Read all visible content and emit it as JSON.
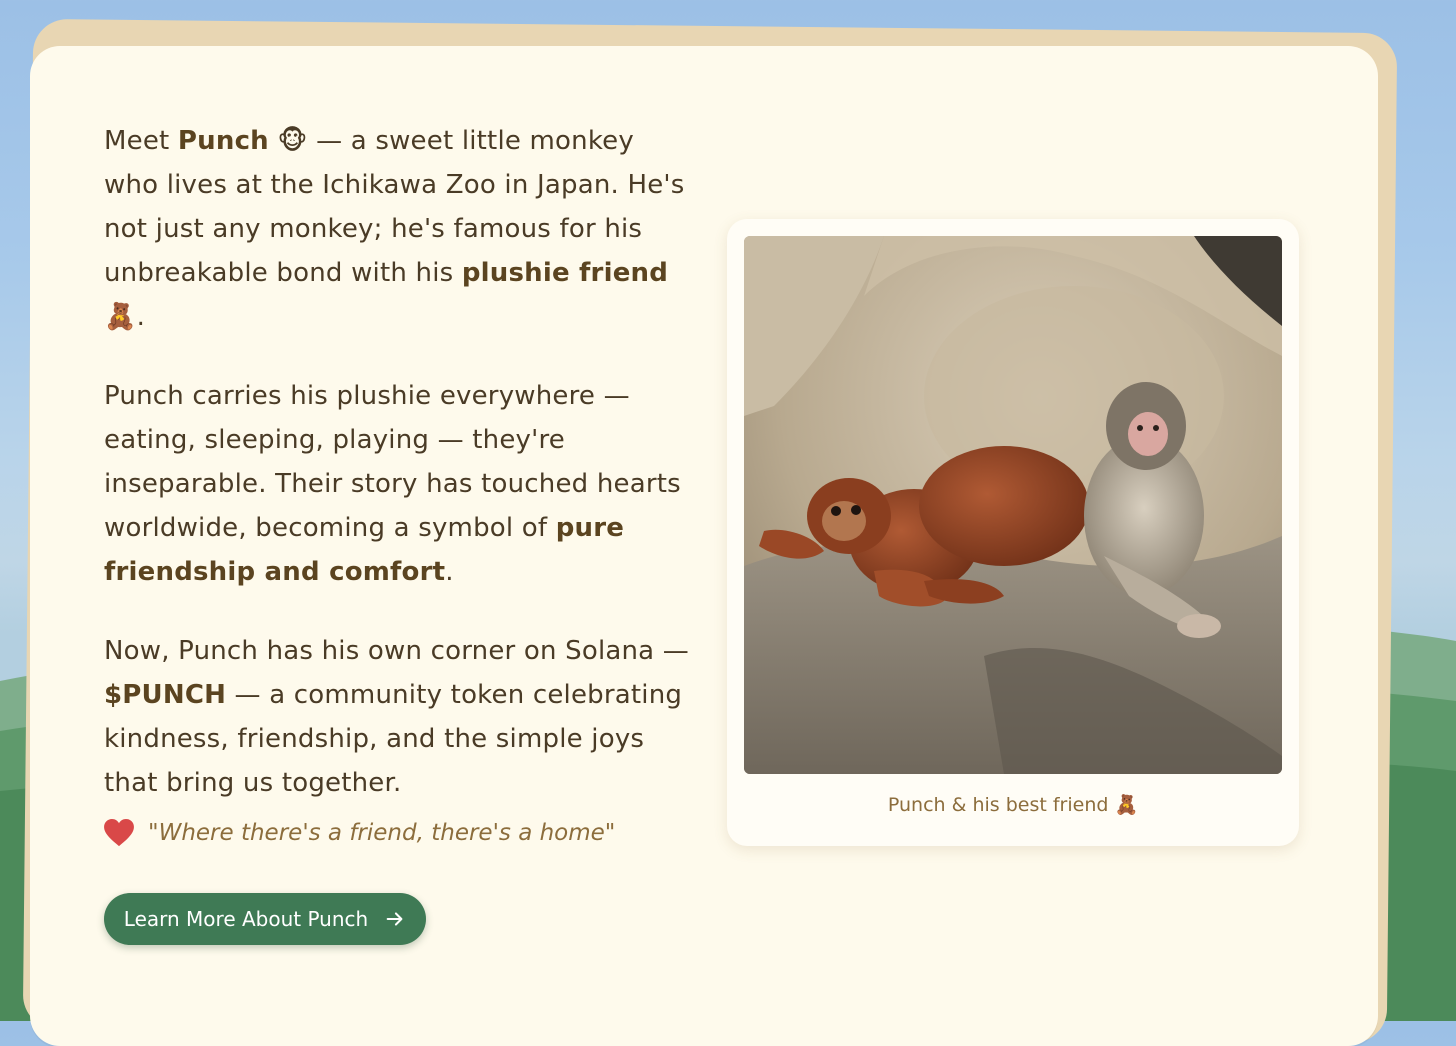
{
  "content": {
    "paragraph_1": {
      "t1": "Meet ",
      "b1": "Punch",
      "e1": "🐵",
      "t2": " — a sweet little monkey who lives at the Ichikawa Zoo in Japan. He's not just any monkey; he's famous for his unbreakable bond with his ",
      "b2": "plushie friend",
      "e2": "🧸",
      "t3": "."
    },
    "paragraph_2": {
      "t1": "Punch carries his plushie everywhere — eating, sleeping, playing — they're inseparable. Their story has touched hearts worldwide, becoming a symbol of ",
      "b1": "pure friendship and comfort",
      "t2": "."
    },
    "paragraph_3": {
      "t1": "Now, Punch has his own corner on Solana — ",
      "b1": "$PUNCH",
      "t2": " — a community token celebrating kindness, friendship, and the simple joys that bring us together."
    },
    "quote": "\"Where there's a friend, there's a home\"",
    "cta_label": "Learn More About Punch"
  },
  "photo": {
    "caption": "Punch & his best friend 🧸"
  },
  "icons": {
    "quote_icon": "heart-icon",
    "cta_icon": "arrow-right-icon"
  },
  "colors": {
    "background_sky": "#a7c9ea",
    "card": "#fefaec",
    "card_edge": "#e8d6b3",
    "body_text": "#4a3b26",
    "accent_text": "#8c6d3c",
    "button": "#3f7a55",
    "heart": "#d94848"
  }
}
